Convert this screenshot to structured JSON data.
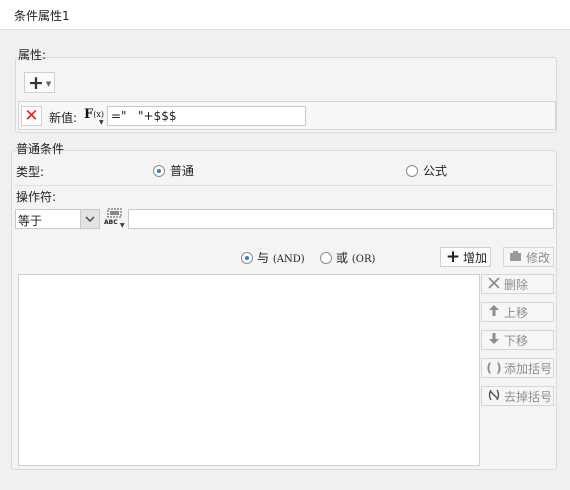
{
  "dialog": {
    "title": "条件属性1"
  },
  "properties": {
    "legend": "属性:",
    "add_button_icon": "plus-icon",
    "row": {
      "delete_icon": "close-x-icon",
      "label": "新值:",
      "formula_icon": "fx-icon",
      "value": "=\"   \"+$$$"
    }
  },
  "conditions": {
    "legend": "普通条件",
    "type_label": "类型:",
    "type_options": [
      {
        "label": "普通",
        "checked": true
      },
      {
        "label": "公式",
        "checked": false
      }
    ],
    "operator_label": "操作符:",
    "operator_value": "等于",
    "operand_value": "",
    "logic_options": [
      {
        "label": "与",
        "suffix": "(AND)",
        "checked": true
      },
      {
        "label": "或",
        "suffix": "(OR)",
        "checked": false
      }
    ],
    "add_button": "增加",
    "modify_button": "修改",
    "side_buttons": [
      {
        "label": "删除",
        "icon": "close-icon"
      },
      {
        "label": "上移",
        "icon": "arrow-up-icon"
      },
      {
        "label": "下移",
        "icon": "arrow-down-icon"
      },
      {
        "label": "添加括号",
        "icon": "parentheses-icon"
      },
      {
        "label": "去掉括号",
        "icon": "remove-parentheses-icon"
      }
    ]
  },
  "colors": {
    "radio_dot": "#3a7bd5",
    "delete_x": "#e02020"
  }
}
